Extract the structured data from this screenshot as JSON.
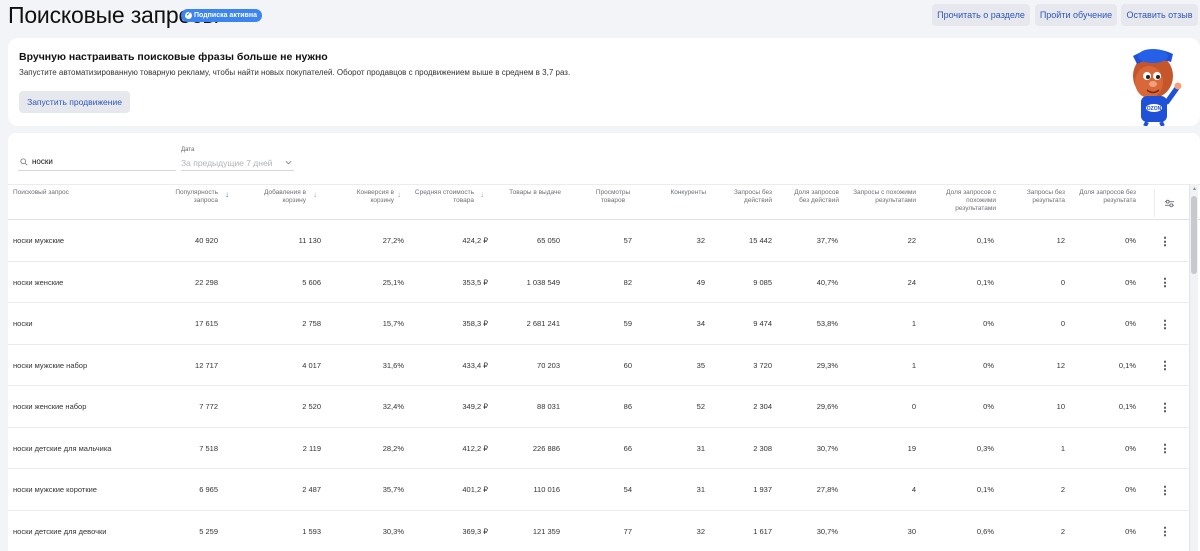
{
  "header": {
    "title": "Поисковые запросы",
    "badge": "Подписка активна",
    "btn_read": "Прочитать о разделе",
    "btn_learn": "Пройти обучение",
    "btn_feedback": "Оставить отзыв"
  },
  "promo": {
    "title": "Вручную настраивать поисковые фразы больше не нужно",
    "text": "Запустите автоматизированную товарную рекламу, чтобы найти новых покупателей. Оборот продавцов с продвижением выше в среднем в 3,7 раз.",
    "button": "Запустить продвижение",
    "mascot_label": "OZON"
  },
  "filters": {
    "search_value": "носки",
    "date_label": "Дата",
    "date_value": "За предыдущие 7 дней"
  },
  "columns": [
    {
      "key": "query",
      "label": "Поисковый запрос"
    },
    {
      "key": "popularity",
      "label": "Популярность запроса"
    },
    {
      "key": "cart",
      "label": "Добавления в корзину"
    },
    {
      "key": "conversion",
      "label": "Конверсия в корзину"
    },
    {
      "key": "avg_price",
      "label": "Средняя стоимость товара"
    },
    {
      "key": "items",
      "label": "Товары в выдаче"
    },
    {
      "key": "views",
      "label": "Просмотры товаров"
    },
    {
      "key": "competitors",
      "label": "Конкуренты"
    },
    {
      "key": "no_action",
      "label": "Запросы без действий"
    },
    {
      "key": "no_action_share",
      "label": "Доля запросов без действий"
    },
    {
      "key": "similar",
      "label": "Запросы с похожими результатами"
    },
    {
      "key": "similar_share",
      "label": "Доля запросов с похожими результатами"
    },
    {
      "key": "no_result",
      "label": "Запросы без результата"
    },
    {
      "key": "no_result_share",
      "label": "Доля запросов без результата"
    }
  ],
  "rows": [
    {
      "query": "носки мужские",
      "popularity": "40 920",
      "cart": "11 130",
      "conversion": "27,2%",
      "avg_price": "424,2 ₽",
      "items": "65 050",
      "views": "57",
      "competitors": "32",
      "no_action": "15 442",
      "no_action_share": "37,7%",
      "similar": "22",
      "similar_share": "0,1%",
      "no_result": "12",
      "no_result_share": "0%"
    },
    {
      "query": "носки женские",
      "popularity": "22 298",
      "cart": "5 606",
      "conversion": "25,1%",
      "avg_price": "353,5 ₽",
      "items": "1 038 549",
      "views": "82",
      "competitors": "49",
      "no_action": "9 085",
      "no_action_share": "40,7%",
      "similar": "24",
      "similar_share": "0,1%",
      "no_result": "0",
      "no_result_share": "0%"
    },
    {
      "query": "носки",
      "popularity": "17 615",
      "cart": "2 758",
      "conversion": "15,7%",
      "avg_price": "358,3 ₽",
      "items": "2 681 241",
      "views": "59",
      "competitors": "34",
      "no_action": "9 474",
      "no_action_share": "53,8%",
      "similar": "1",
      "similar_share": "0%",
      "no_result": "0",
      "no_result_share": "0%"
    },
    {
      "query": "носки мужские набор",
      "popularity": "12 717",
      "cart": "4 017",
      "conversion": "31,6%",
      "avg_price": "433,4 ₽",
      "items": "70 203",
      "views": "60",
      "competitors": "35",
      "no_action": "3 720",
      "no_action_share": "29,3%",
      "similar": "1",
      "similar_share": "0%",
      "no_result": "12",
      "no_result_share": "0,1%"
    },
    {
      "query": "носки женские набор",
      "popularity": "7 772",
      "cart": "2 520",
      "conversion": "32,4%",
      "avg_price": "349,2 ₽",
      "items": "88 031",
      "views": "86",
      "competitors": "52",
      "no_action": "2 304",
      "no_action_share": "29,6%",
      "similar": "0",
      "similar_share": "0%",
      "no_result": "10",
      "no_result_share": "0,1%"
    },
    {
      "query": "носки детские для мальчика",
      "popularity": "7 518",
      "cart": "2 119",
      "conversion": "28,2%",
      "avg_price": "412,2 ₽",
      "items": "226 886",
      "views": "66",
      "competitors": "31",
      "no_action": "2 308",
      "no_action_share": "30,7%",
      "similar": "19",
      "similar_share": "0,3%",
      "no_result": "1",
      "no_result_share": "0%"
    },
    {
      "query": "носки мужские короткие",
      "popularity": "6 965",
      "cart": "2 487",
      "conversion": "35,7%",
      "avg_price": "401,2 ₽",
      "items": "110 016",
      "views": "54",
      "competitors": "31",
      "no_action": "1 937",
      "no_action_share": "27,8%",
      "similar": "4",
      "similar_share": "0,1%",
      "no_result": "2",
      "no_result_share": "0%"
    },
    {
      "query": "носки детские для девочки",
      "popularity": "5 259",
      "cart": "1 593",
      "conversion": "30,3%",
      "avg_price": "369,3 ₽",
      "items": "121 359",
      "views": "77",
      "competitors": "32",
      "no_action": "1 617",
      "no_action_share": "30,7%",
      "similar": "30",
      "similar_share": "0,6%",
      "no_result": "2",
      "no_result_share": "0%"
    }
  ],
  "colors": {
    "accent": "#3c84f0",
    "link": "#2e56b8",
    "button_bg": "#e6e8ee"
  }
}
